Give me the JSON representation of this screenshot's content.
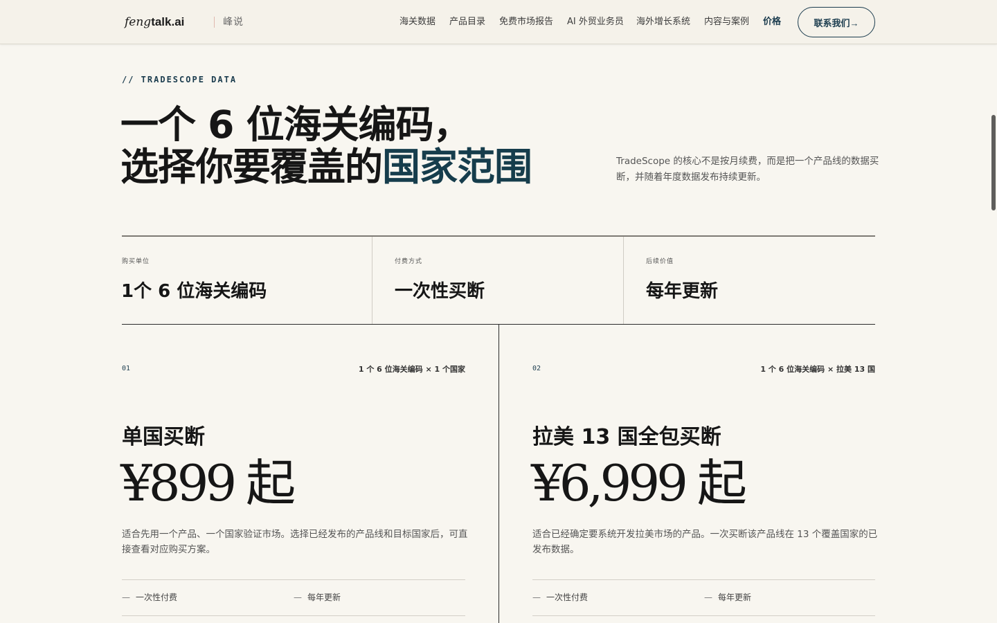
{
  "header": {
    "logo_feng": "feng",
    "logo_rest": "talk.ai",
    "logo_cn": "峰说",
    "nav": [
      {
        "label": "海关数据",
        "active": false
      },
      {
        "label": "产品目录",
        "active": false
      },
      {
        "label": "免费市场报告",
        "active": false
      },
      {
        "label": "AI 外贸业务员",
        "active": false
      },
      {
        "label": "海外增长系统",
        "active": false
      },
      {
        "label": "内容与案例",
        "active": false
      },
      {
        "label": "价格",
        "active": true
      }
    ],
    "cta_label": "联系我们→"
  },
  "hero": {
    "eyebrow": "// TRADESCOPE DATA",
    "title_line1": "一个 6 位海关编码，",
    "title_line2_a": "选择你要覆盖的",
    "title_line2_b": "国家范围",
    "description": "TradeScope 的核心不是按月续费，而是把一个产品线的数据买断，并随着年度数据发布持续更新。"
  },
  "stats": [
    {
      "label": "购买单位",
      "value": "1个 6 位海关编码"
    },
    {
      "label": "付费方式",
      "value": "一次性买断"
    },
    {
      "label": "后续价值",
      "value": "每年更新"
    }
  ],
  "plans": [
    {
      "number": "01",
      "tag": "1 个 6 位海关编码 × 1 个国家",
      "name": "单国买断",
      "price": "¥899 起",
      "description": "适合先用一个产品、一个国家验证市场。选择已经发布的产品线和目标国家后，可直接查看对应购买方案。",
      "features": [
        "一次性付费",
        "每年更新"
      ]
    },
    {
      "number": "02",
      "tag": "1 个 6 位海关编码 × 拉美 13 国",
      "name": "拉美 13 国全包买断",
      "price": "¥6,999 起",
      "description": "适合已经确定要系统开发拉美市场的产品。一次买断该产品线在 13 个覆盖国家的已发布数据。",
      "features": [
        "一次性付费",
        "每年更新"
      ]
    }
  ],
  "icons": {
    "dash": "—"
  }
}
